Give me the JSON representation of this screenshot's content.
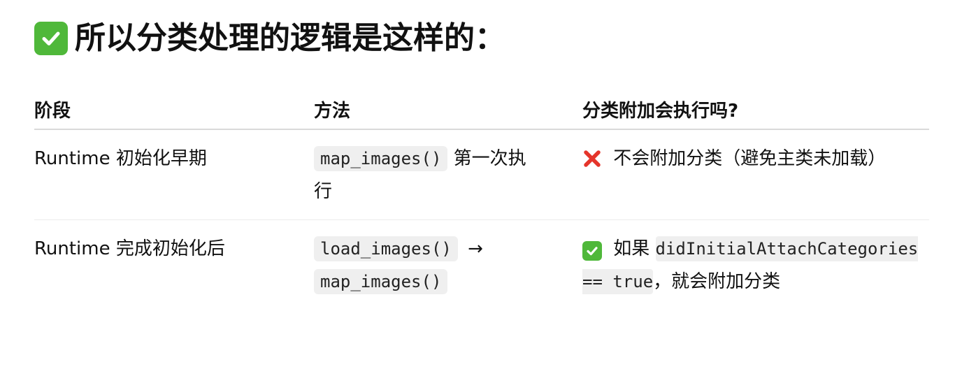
{
  "heading": {
    "icon": "check-mark-button-icon",
    "text": "所以分类处理的逻辑是这样的："
  },
  "table": {
    "headers": [
      "阶段",
      "方法",
      "分类附加会执行吗?"
    ],
    "rows": [
      {
        "stage": "Runtime 初始化早期",
        "method_code": "map_images()",
        "method_text": " 第一次执行",
        "result_icon": "cross-mark-icon",
        "result_text": " 不会附加分类（避免主类未加载）"
      },
      {
        "stage": "Runtime 完成初始化后",
        "method_code_1": "load_images()",
        "method_arrow": " →",
        "method_code_2": "map_images()",
        "result_icon": "check-mark-button-icon",
        "result_prefix": " 如果 ",
        "result_code": "didInitialAttachCategories == true",
        "result_suffix": "，就会附加分类"
      }
    ]
  },
  "colors": {
    "check_green": "#4fb83a",
    "cross_red": "#e5352b",
    "code_bg": "#efefef"
  }
}
